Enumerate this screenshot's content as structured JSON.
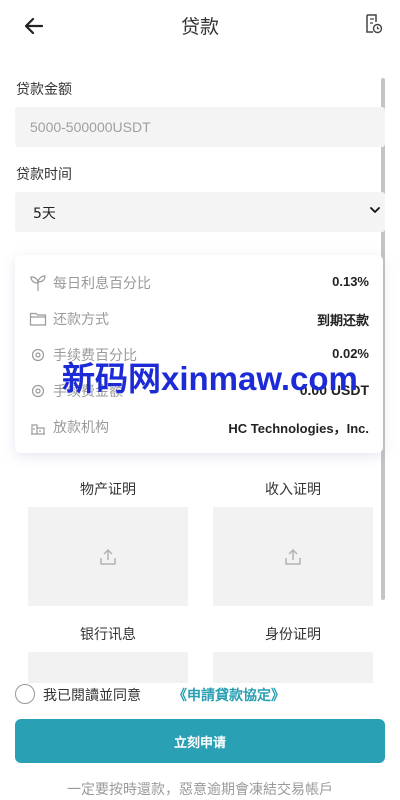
{
  "header": {
    "title": "贷款",
    "back_icon": "arrow-left-icon",
    "record_icon": "document-clock-icon"
  },
  "form": {
    "amount_label": "贷款金额",
    "amount_placeholder": "5000-500000USDT",
    "time_label": "贷款时间",
    "time_selected": "5天"
  },
  "details": {
    "rows": [
      {
        "icon": "sprout-icon",
        "label": "每日利息百分比",
        "value": "0.13%"
      },
      {
        "icon": "folder-icon",
        "label": "还款方式",
        "value": "到期还款"
      },
      {
        "icon": "gear-icon",
        "label": "手续费百分比",
        "value": "0.02%"
      },
      {
        "icon": "gear-icon",
        "label": "手续费金额",
        "value": "0.00 USDT"
      },
      {
        "icon": "bank-icon",
        "label": "放款机构",
        "value": "HC Technologies，Inc."
      }
    ]
  },
  "watermark": "新码网xinmaw.com",
  "documents": {
    "property": "物产证明",
    "income": "收入证明",
    "bank": "银行讯息",
    "identity": "身份证明"
  },
  "agreement": {
    "text": "我已閱讀並同意",
    "link": "《申請貸款協定》"
  },
  "submit_label": "立刻申请",
  "footer_note": "一定要按時還款，惡意逾期會凍結交易帳戶",
  "colors": {
    "accent": "#2aa0b4",
    "watermark": "#1d2bd6"
  }
}
